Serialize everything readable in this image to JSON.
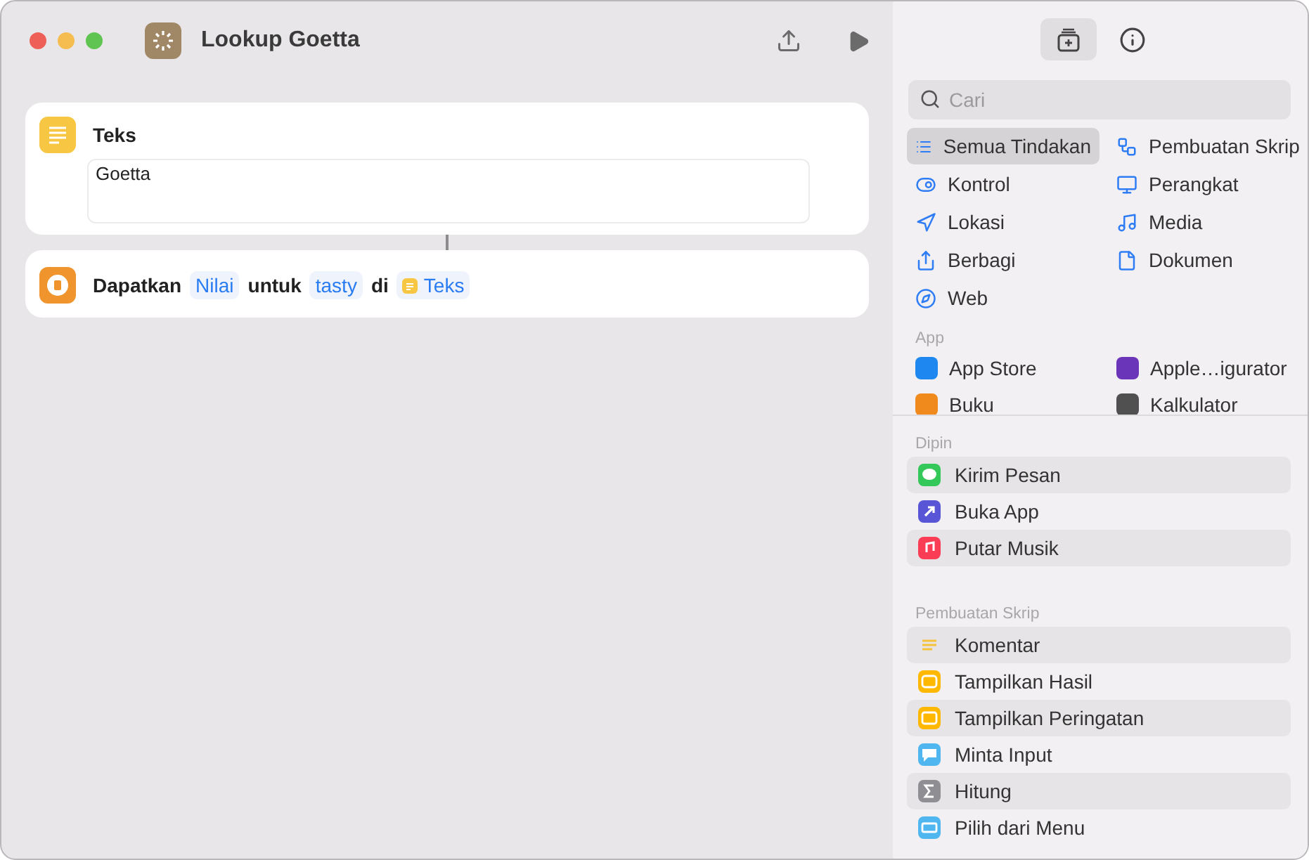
{
  "window": {
    "title": "Lookup Goetta"
  },
  "actions": [
    {
      "kind": "text",
      "title": "Teks",
      "value": "Goetta"
    },
    {
      "kind": "dictionary",
      "parts": [
        {
          "kind": "word",
          "text": "Dapatkan"
        },
        {
          "kind": "token",
          "text": "Nilai"
        },
        {
          "kind": "word",
          "text": "untuk"
        },
        {
          "kind": "token",
          "text": "tasty"
        },
        {
          "kind": "word",
          "text": "di"
        },
        {
          "kind": "variable",
          "text": "Teks"
        }
      ]
    }
  ],
  "sidebar": {
    "tabs": [
      {
        "kind": "library",
        "selected": true
      },
      {
        "kind": "info",
        "selected": false
      }
    ],
    "search": {
      "placeholder": "Cari"
    },
    "categories": [
      {
        "kind": "list",
        "label": "Semua Tindakan",
        "selected": true
      },
      {
        "kind": "script",
        "label": "Pembuatan Skrip",
        "selected": false
      },
      {
        "kind": "toggle",
        "label": "Kontrol",
        "selected": false
      },
      {
        "kind": "monitor",
        "label": "Perangkat",
        "selected": false
      },
      {
        "kind": "location",
        "label": "Lokasi",
        "selected": false
      },
      {
        "kind": "music",
        "label": "Media",
        "selected": false
      },
      {
        "kind": "share",
        "label": "Berbagi",
        "selected": false
      },
      {
        "kind": "document",
        "label": "Dokumen",
        "selected": false
      },
      {
        "kind": "web",
        "label": "Web",
        "selected": false
      }
    ],
    "apps_heading": "App",
    "apps": [
      {
        "label": "App Store",
        "color": "#1e88f0"
      },
      {
        "label": "Apple…igurator",
        "color": "#6a35b8"
      },
      {
        "label": "Buku",
        "color": "#f08a1c"
      },
      {
        "label": "Kalkulator",
        "color": "#505050"
      }
    ],
    "sections": [
      {
        "heading": "Dipin",
        "items": [
          {
            "kind": "bubble",
            "label": "Kirim Pesan",
            "color": "#34c759"
          },
          {
            "kind": "arrow",
            "label": "Buka App",
            "color": "#5856d6"
          },
          {
            "kind": "note",
            "label": "Putar Musik",
            "color": "#fa3d55"
          }
        ]
      },
      {
        "heading": "Pembuatan Skrip",
        "items": [
          {
            "kind": "lines",
            "label": "Komentar",
            "color": "#f5c33b"
          },
          {
            "kind": "quicklook",
            "label": "Tampilkan Hasil",
            "color": "#ffb800"
          },
          {
            "kind": "alert",
            "label": "Tampilkan Peringatan",
            "color": "#ffb800"
          },
          {
            "kind": "ask",
            "label": "Minta Input",
            "color": "#4fb6f0"
          },
          {
            "kind": "sigma",
            "label": "Hitung",
            "color": "#8e8e93"
          },
          {
            "kind": "menu",
            "label": "Pilih dari Menu",
            "color": "#4fb6f0"
          }
        ]
      }
    ]
  }
}
